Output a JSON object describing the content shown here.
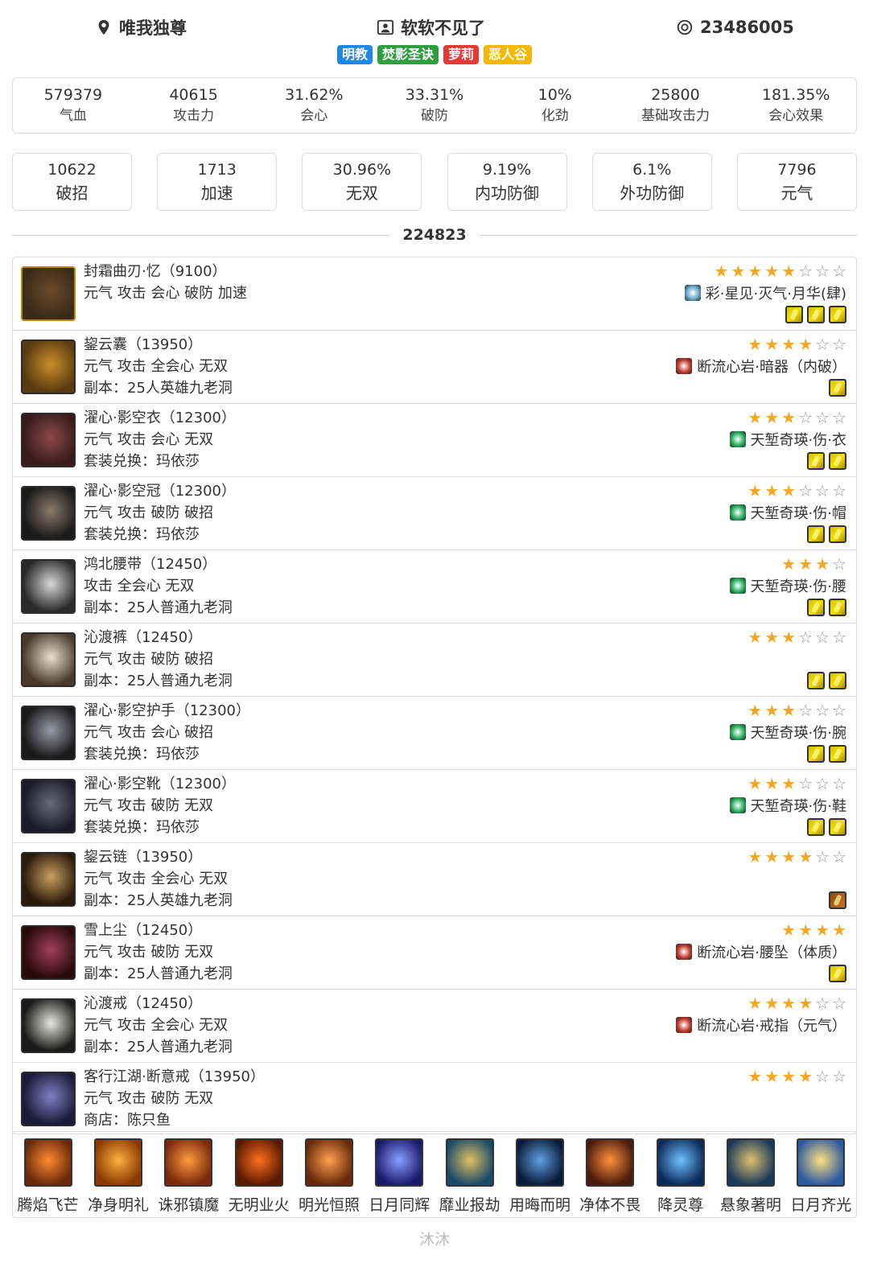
{
  "header": {
    "server": "唯我独尊",
    "name": "软软不见了",
    "uid": "23486005",
    "tags": [
      {
        "label": "明教",
        "color": "#1e88e5"
      },
      {
        "label": "焚影圣诀",
        "color": "#2e9e3e"
      },
      {
        "label": "萝莉",
        "color": "#e53935"
      },
      {
        "label": "恶人谷",
        "color": "#f5b800"
      }
    ]
  },
  "stats_main": [
    {
      "value": "579379",
      "label": "气血"
    },
    {
      "value": "40615",
      "label": "攻击力"
    },
    {
      "value": "31.62%",
      "label": "会心"
    },
    {
      "value": "33.31%",
      "label": "破防"
    },
    {
      "value": "10%",
      "label": "化劲"
    },
    {
      "value": "25800",
      "label": "基础攻击力"
    },
    {
      "value": "181.35%",
      "label": "会心效果"
    }
  ],
  "stats_secondary": [
    {
      "value": "10622",
      "label": "破招"
    },
    {
      "value": "1713",
      "label": "加速"
    },
    {
      "value": "30.96%",
      "label": "无双"
    },
    {
      "value": "9.19%",
      "label": "内功防御"
    },
    {
      "value": "6.1%",
      "label": "外功防御"
    },
    {
      "value": "7796",
      "label": "元气"
    }
  ],
  "score": "224823",
  "equipment": [
    {
      "name": "封霜曲刃·忆（9100）",
      "attrs": "元气 攻击 会心 破防 加速",
      "source": "",
      "stars_on": 5,
      "stars_total": 8,
      "gem": "彩·星见·灭气·月华(肆)",
      "gem_color": "#6aa8c8",
      "slots": 3,
      "icon_colors": [
        "#3a2a1a",
        "#6b4a2a"
      ],
      "gold": true
    },
    {
      "name": "鋆云囊（13950）",
      "attrs": "元气 攻击 全会心 无双",
      "source": "副本：25人英雄九老洞",
      "stars_on": 4,
      "stars_total": 6,
      "gem": "断流心岩·暗器（内破）",
      "gem_color": "#c0392b",
      "slots": 1,
      "icon_colors": [
        "#5a3a10",
        "#c8902a"
      ],
      "gold": false
    },
    {
      "name": "濯心·影空衣（12300）",
      "attrs": "元气 攻击 会心 无双",
      "source": "套装兑换：玛依莎",
      "stars_on": 3,
      "stars_total": 6,
      "gem": "天堑奇瑛·伤·衣",
      "gem_color": "#27ae60",
      "slots": 2,
      "icon_colors": [
        "#3a1a1a",
        "#8a4a4a"
      ],
      "gold": false
    },
    {
      "name": "濯心·影空冠（12300）",
      "attrs": "元气 攻击 破防 破招",
      "source": "套装兑换：玛依莎",
      "stars_on": 3,
      "stars_total": 6,
      "gem": "天堑奇瑛·伤·帽",
      "gem_color": "#27ae60",
      "slots": 2,
      "icon_colors": [
        "#1a1a1a",
        "#8a7a6a"
      ],
      "gold": false
    },
    {
      "name": "鸿北腰带（12450）",
      "attrs": "攻击 全会心 无双",
      "source": "副本：25人普通九老洞",
      "stars_on": 3,
      "stars_total": 4,
      "gem": "天堑奇瑛·伤·腰",
      "gem_color": "#27ae60",
      "slots": 2,
      "icon_colors": [
        "#2a2a2a",
        "#d8d8d8"
      ],
      "gold": false
    },
    {
      "name": "沁渡裤（12450）",
      "attrs": "元气 攻击 破防 破招",
      "source": "副本：25人普通九老洞",
      "stars_on": 3,
      "stars_total": 6,
      "gem": "",
      "gem_color": "",
      "slots": 2,
      "icon_colors": [
        "#4a3a2a",
        "#e8e0d0"
      ],
      "gold": false
    },
    {
      "name": "濯心·影空护手（12300）",
      "attrs": "元气 攻击 会心 破招",
      "source": "套装兑换：玛依莎",
      "stars_on": 3,
      "stars_total": 6,
      "gem": "天堑奇瑛·伤·腕",
      "gem_color": "#27ae60",
      "slots": 2,
      "icon_colors": [
        "#1a1a1a",
        "#9a9aaa"
      ],
      "gold": false
    },
    {
      "name": "濯心·影空靴（12300）",
      "attrs": "元气 攻击 破防 无双",
      "source": "套装兑换：玛依莎",
      "stars_on": 3,
      "stars_total": 6,
      "gem": "天堑奇瑛·伤·鞋",
      "gem_color": "#27ae60",
      "slots": 2,
      "icon_colors": [
        "#1a1a2a",
        "#6a6a7a"
      ],
      "gold": false
    },
    {
      "name": "鋆云链（13950）",
      "attrs": "元气 攻击 全会心 无双",
      "source": "副本：25人英雄九老洞",
      "stars_on": 4,
      "stars_total": 6,
      "gem": "",
      "gem_color": "",
      "slots": 1,
      "slot_brown": true,
      "icon_colors": [
        "#2a1a0a",
        "#c8a060"
      ],
      "gold": false
    },
    {
      "name": "雪上尘（12450）",
      "attrs": "元气 攻击 破防 无双",
      "source": "副本：25人普通九老洞",
      "stars_on": 4,
      "stars_total": 4,
      "gem": "断流心岩·腰坠（体质）",
      "gem_color": "#c0392b",
      "slots": 1,
      "icon_colors": [
        "#2a0a0a",
        "#a04060"
      ],
      "gold": false
    },
    {
      "name": "沁渡戒（12450）",
      "attrs": "元气 攻击 全会心 无双",
      "source": "副本：25人普通九老洞",
      "stars_on": 4,
      "stars_total": 6,
      "gem": "断流心岩·戒指（元气）",
      "gem_color": "#c0392b",
      "slots": 0,
      "icon_colors": [
        "#1a1a1a",
        "#e8e8e0"
      ],
      "gold": false
    },
    {
      "name": "客行江湖·断意戒（13950）",
      "attrs": "元气 攻击 破防 无双",
      "source": "商店：陈只鱼",
      "stars_on": 4,
      "stars_total": 6,
      "gem": "",
      "gem_color": "",
      "slots": 0,
      "icon_colors": [
        "#1a1a3a",
        "#8080c0"
      ],
      "gold": false
    }
  ],
  "skills": [
    {
      "label": "腾焰飞芒",
      "c1": "#ff8a30",
      "c2": "#6a2a0a"
    },
    {
      "label": "净身明礼",
      "c1": "#ffb040",
      "c2": "#8a3a00"
    },
    {
      "label": "诛邪镇魔",
      "c1": "#ff9a40",
      "c2": "#7a2a0a"
    },
    {
      "label": "无明业火",
      "c1": "#ff7020",
      "c2": "#5a1a00"
    },
    {
      "label": "明光恒照",
      "c1": "#ffa050",
      "c2": "#6a2a0a"
    },
    {
      "label": "日月同辉",
      "c1": "#8aa0ff",
      "c2": "#1a1a6a"
    },
    {
      "label": "靡业报劫",
      "c1": "#e0c060",
      "c2": "#1a4a6a"
    },
    {
      "label": "用晦而明",
      "c1": "#60a0e0",
      "c2": "#0a1a3a"
    },
    {
      "label": "净体不畏",
      "c1": "#ff9040",
      "c2": "#4a1a0a"
    },
    {
      "label": "降灵尊",
      "c1": "#70c0ff",
      "c2": "#0a2a5a"
    },
    {
      "label": "悬象著明",
      "c1": "#e0c070",
      "c2": "#1a3a5a"
    },
    {
      "label": "日月齐光",
      "c1": "#ffe080",
      "c2": "#2a5aa0"
    }
  ],
  "footer": "沐沐"
}
